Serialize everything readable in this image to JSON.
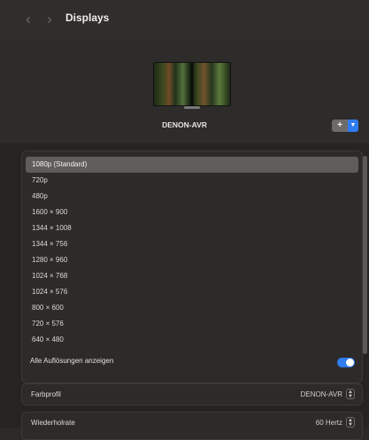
{
  "toolbar": {
    "back_icon": "chevron-left-icon",
    "forward_icon": "chevron-right-icon",
    "title": "Displays"
  },
  "display": {
    "name": "DENON-AVR",
    "add_label": "+",
    "add_menu_icon": "chevron-down-icon"
  },
  "resolutions": {
    "selected": "1080p (Standard)",
    "items": [
      "1080p (Standard)",
      "720p",
      "480p",
      "1600 × 900",
      "1344 × 1008",
      "1344 × 756",
      "1280 × 960",
      "1024 × 768",
      "1024 × 576",
      "800 × 600",
      "720 × 576",
      "640 × 480"
    ],
    "show_all_label": "Alle Auflösungen anzeigen",
    "show_all_enabled": true
  },
  "settings": {
    "color_profile_label": "Farbprofil",
    "color_profile_value": "DENON-AVR",
    "refresh_rate_label": "Wiederholrate",
    "refresh_rate_value": "60 Hertz"
  },
  "colors": {
    "accent": "#2f7bf0",
    "selection": "#5e5d5a",
    "background": "#252422"
  }
}
